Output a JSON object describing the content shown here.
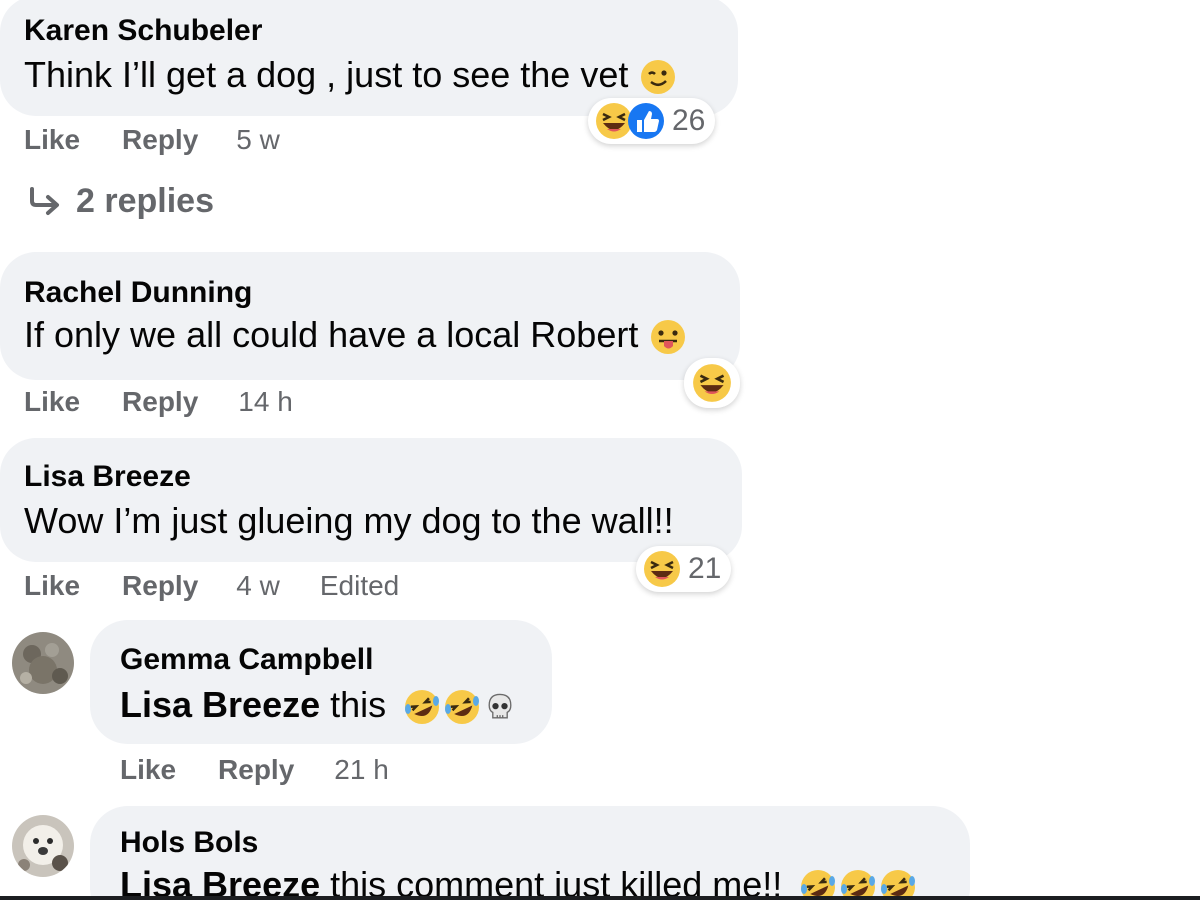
{
  "comments": [
    {
      "author": "Karen Schubeler",
      "text": "Think I’ll get a dog , just to see the vet",
      "text_emoji": [
        "winking-face"
      ],
      "actions": {
        "like": "Like",
        "reply": "Reply",
        "time": "5 w"
      },
      "reactions": {
        "icons": [
          "laughing-face",
          "thumbs-up"
        ],
        "count": "26"
      },
      "replies_link": "2 replies"
    },
    {
      "author": "Rachel Dunning",
      "text": "If only we all could have a local Robert",
      "text_emoji": [
        "face-with-tongue"
      ],
      "actions": {
        "like": "Like",
        "reply": "Reply",
        "time": "14 h"
      },
      "reactions": {
        "icons": [
          "laughing-face"
        ],
        "count": ""
      }
    },
    {
      "author": "Lisa Breeze",
      "text": "Wow I’m just glueing my dog to the wall!!",
      "actions": {
        "like": "Like",
        "reply": "Reply",
        "time": "4 w",
        "edited": "Edited"
      },
      "reactions": {
        "icons": [
          "laughing-face"
        ],
        "count": "21"
      }
    }
  ],
  "replies": [
    {
      "author": "Gemma Campbell",
      "mention": "Lisa Breeze",
      "text": " this",
      "text_emoji": [
        "rolling-laughing-face",
        "rolling-laughing-face",
        "skull"
      ],
      "actions": {
        "like": "Like",
        "reply": "Reply",
        "time": "21 h"
      }
    },
    {
      "author": "Hols Bols",
      "mention": "Lisa Breeze",
      "text": " this comment just killed me!!",
      "text_emoji": [
        "rolling-laughing-face",
        "rolling-laughing-face",
        "rolling-laughing-face"
      ]
    }
  ],
  "colors": {
    "bubble_bg": "#f0f2f5",
    "meta_text": "#65676b",
    "like_blue": "#1877f2",
    "emoji_yellow": "#f7c948"
  }
}
